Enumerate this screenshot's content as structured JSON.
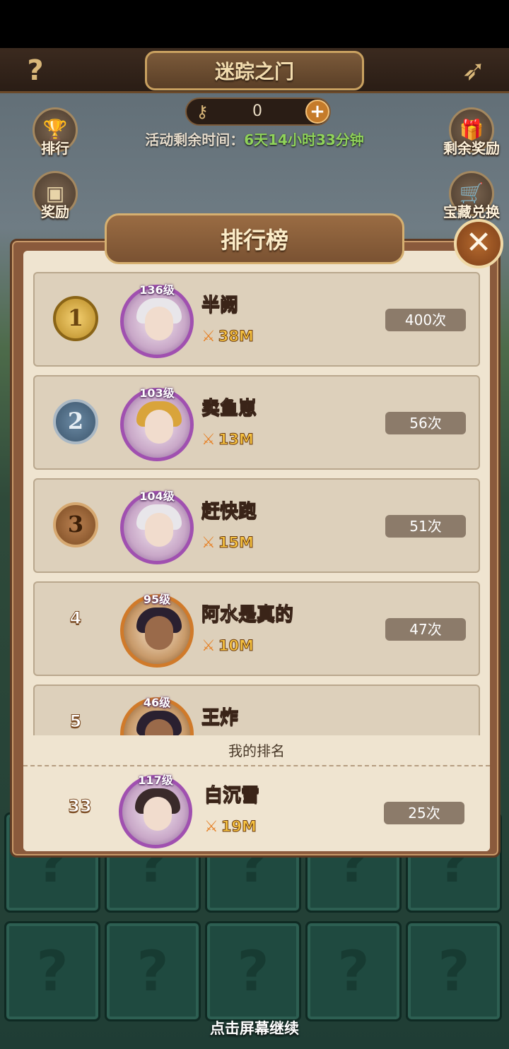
{
  "header": {
    "title": "迷踪之门",
    "help_glyph": "?",
    "back_glyph": "➶"
  },
  "keys": {
    "count": "0",
    "plus": "+"
  },
  "timer": {
    "label": "活动剩余时间：",
    "value": "6天14小时33分钟"
  },
  "side_buttons": {
    "ranking": "排行",
    "reward": "奖励",
    "remaining_reward": "剩余奖励",
    "treasure": "宝藏兑换"
  },
  "modal": {
    "title": "排行榜",
    "close_glyph": "✕",
    "my_rank_label": "我的排名"
  },
  "rows": [
    {
      "rank": "1",
      "level": "136级",
      "name": "半阙",
      "power": "38M",
      "count": "400次"
    },
    {
      "rank": "2",
      "level": "103级",
      "name": "卖鱼崽",
      "power": "13M",
      "count": "56次"
    },
    {
      "rank": "3",
      "level": "104级",
      "name": "赶快跑",
      "power": "15M",
      "count": "51次"
    },
    {
      "rank": "4",
      "level": "95级",
      "name": "阿水是真的",
      "power": "10M",
      "count": "47次"
    },
    {
      "rank": "5",
      "level": "46级",
      "name": "王炸",
      "power": "",
      "count": ""
    }
  ],
  "my_row": {
    "rank": "33",
    "level": "117级",
    "name": "白沉雪",
    "power": "19M",
    "count": "25次"
  },
  "card_mark": "?",
  "continue_text": "点击屏幕继续",
  "icons": {
    "medal_gold": "#f4d072",
    "medal_silver": "#6b8aa4",
    "medal_bronze": "#b98050",
    "sword": "⚔"
  }
}
